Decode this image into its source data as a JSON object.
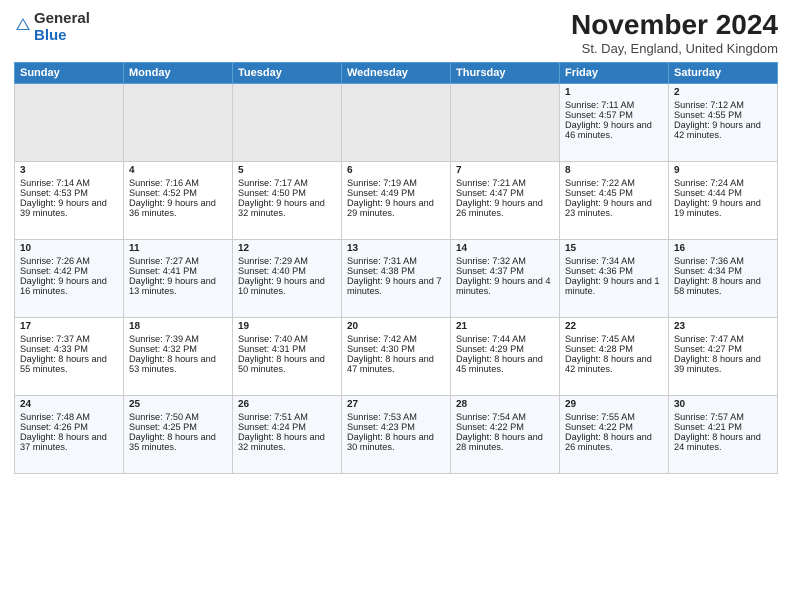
{
  "header": {
    "logo_general": "General",
    "logo_blue": "Blue",
    "month_title": "November 2024",
    "subtitle": "St. Day, England, United Kingdom"
  },
  "columns": [
    "Sunday",
    "Monday",
    "Tuesday",
    "Wednesday",
    "Thursday",
    "Friday",
    "Saturday"
  ],
  "weeks": [
    {
      "days": [
        {
          "num": "",
          "info": "",
          "empty": true
        },
        {
          "num": "",
          "info": "",
          "empty": true
        },
        {
          "num": "",
          "info": "",
          "empty": true
        },
        {
          "num": "",
          "info": "",
          "empty": true
        },
        {
          "num": "",
          "info": "",
          "empty": true
        },
        {
          "num": "1",
          "info": "Sunrise: 7:11 AM\nSunset: 4:57 PM\nDaylight: 9 hours and 46 minutes."
        },
        {
          "num": "2",
          "info": "Sunrise: 7:12 AM\nSunset: 4:55 PM\nDaylight: 9 hours and 42 minutes."
        }
      ]
    },
    {
      "days": [
        {
          "num": "3",
          "info": "Sunrise: 7:14 AM\nSunset: 4:53 PM\nDaylight: 9 hours and 39 minutes."
        },
        {
          "num": "4",
          "info": "Sunrise: 7:16 AM\nSunset: 4:52 PM\nDaylight: 9 hours and 36 minutes."
        },
        {
          "num": "5",
          "info": "Sunrise: 7:17 AM\nSunset: 4:50 PM\nDaylight: 9 hours and 32 minutes."
        },
        {
          "num": "6",
          "info": "Sunrise: 7:19 AM\nSunset: 4:49 PM\nDaylight: 9 hours and 29 minutes."
        },
        {
          "num": "7",
          "info": "Sunrise: 7:21 AM\nSunset: 4:47 PM\nDaylight: 9 hours and 26 minutes."
        },
        {
          "num": "8",
          "info": "Sunrise: 7:22 AM\nSunset: 4:45 PM\nDaylight: 9 hours and 23 minutes."
        },
        {
          "num": "9",
          "info": "Sunrise: 7:24 AM\nSunset: 4:44 PM\nDaylight: 9 hours and 19 minutes."
        }
      ]
    },
    {
      "days": [
        {
          "num": "10",
          "info": "Sunrise: 7:26 AM\nSunset: 4:42 PM\nDaylight: 9 hours and 16 minutes."
        },
        {
          "num": "11",
          "info": "Sunrise: 7:27 AM\nSunset: 4:41 PM\nDaylight: 9 hours and 13 minutes."
        },
        {
          "num": "12",
          "info": "Sunrise: 7:29 AM\nSunset: 4:40 PM\nDaylight: 9 hours and 10 minutes."
        },
        {
          "num": "13",
          "info": "Sunrise: 7:31 AM\nSunset: 4:38 PM\nDaylight: 9 hours and 7 minutes."
        },
        {
          "num": "14",
          "info": "Sunrise: 7:32 AM\nSunset: 4:37 PM\nDaylight: 9 hours and 4 minutes."
        },
        {
          "num": "15",
          "info": "Sunrise: 7:34 AM\nSunset: 4:36 PM\nDaylight: 9 hours and 1 minute."
        },
        {
          "num": "16",
          "info": "Sunrise: 7:36 AM\nSunset: 4:34 PM\nDaylight: 8 hours and 58 minutes."
        }
      ]
    },
    {
      "days": [
        {
          "num": "17",
          "info": "Sunrise: 7:37 AM\nSunset: 4:33 PM\nDaylight: 8 hours and 55 minutes."
        },
        {
          "num": "18",
          "info": "Sunrise: 7:39 AM\nSunset: 4:32 PM\nDaylight: 8 hours and 53 minutes."
        },
        {
          "num": "19",
          "info": "Sunrise: 7:40 AM\nSunset: 4:31 PM\nDaylight: 8 hours and 50 minutes."
        },
        {
          "num": "20",
          "info": "Sunrise: 7:42 AM\nSunset: 4:30 PM\nDaylight: 8 hours and 47 minutes."
        },
        {
          "num": "21",
          "info": "Sunrise: 7:44 AM\nSunset: 4:29 PM\nDaylight: 8 hours and 45 minutes."
        },
        {
          "num": "22",
          "info": "Sunrise: 7:45 AM\nSunset: 4:28 PM\nDaylight: 8 hours and 42 minutes."
        },
        {
          "num": "23",
          "info": "Sunrise: 7:47 AM\nSunset: 4:27 PM\nDaylight: 8 hours and 39 minutes."
        }
      ]
    },
    {
      "days": [
        {
          "num": "24",
          "info": "Sunrise: 7:48 AM\nSunset: 4:26 PM\nDaylight: 8 hours and 37 minutes."
        },
        {
          "num": "25",
          "info": "Sunrise: 7:50 AM\nSunset: 4:25 PM\nDaylight: 8 hours and 35 minutes."
        },
        {
          "num": "26",
          "info": "Sunrise: 7:51 AM\nSunset: 4:24 PM\nDaylight: 8 hours and 32 minutes."
        },
        {
          "num": "27",
          "info": "Sunrise: 7:53 AM\nSunset: 4:23 PM\nDaylight: 8 hours and 30 minutes."
        },
        {
          "num": "28",
          "info": "Sunrise: 7:54 AM\nSunset: 4:22 PM\nDaylight: 8 hours and 28 minutes."
        },
        {
          "num": "29",
          "info": "Sunrise: 7:55 AM\nSunset: 4:22 PM\nDaylight: 8 hours and 26 minutes."
        },
        {
          "num": "30",
          "info": "Sunrise: 7:57 AM\nSunset: 4:21 PM\nDaylight: 8 hours and 24 minutes."
        }
      ]
    }
  ]
}
